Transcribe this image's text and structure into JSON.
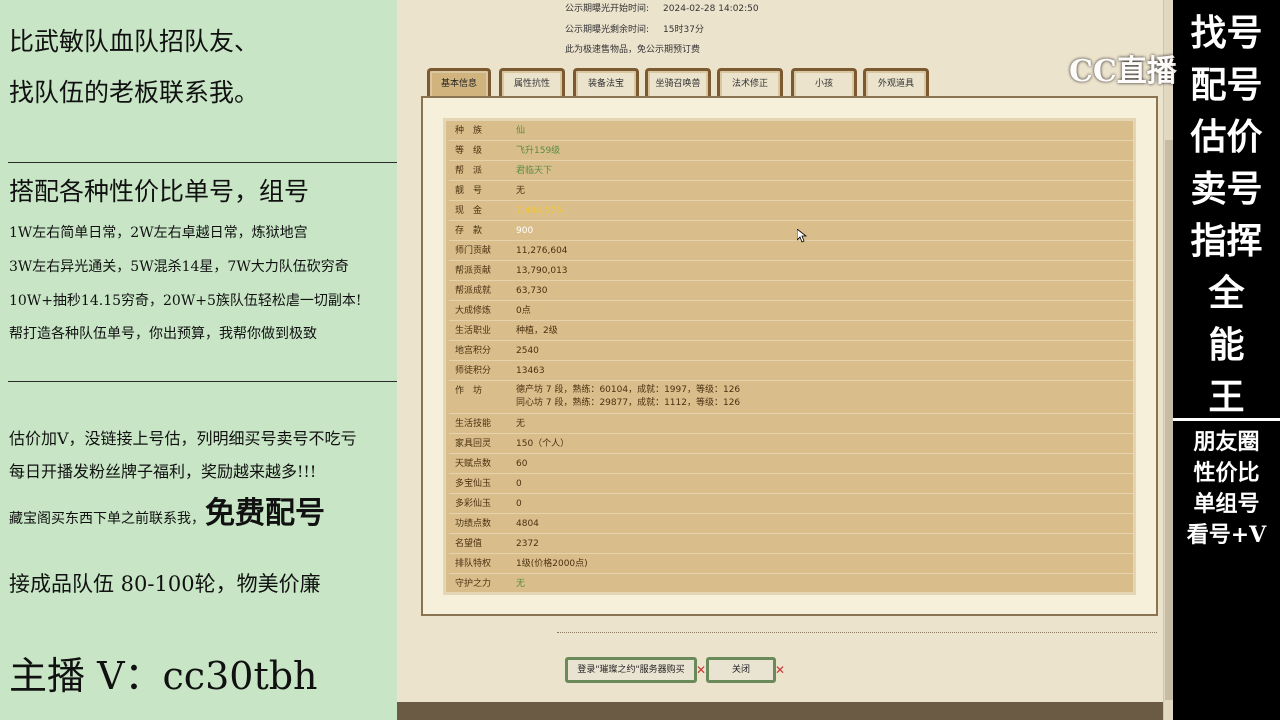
{
  "left": {
    "line1": "比武敏队血队招队友、",
    "line2": "找队伍的老板联系我。",
    "line3": "搭配各种性价比单号，组号",
    "line4": "1W左右简单日常，2W左右卓越日常，炼狱地宫",
    "line5": "3W左右异光通关，5W混杀14星，7W大力队伍砍穷奇",
    "line6": "10W+抽秒14.15穷奇，20W+5族队伍轻松虐一切副本!",
    "line7": "帮打造各种队伍单号，你出预算，我帮你做到极致",
    "line8": "估价加V，没链接上号估，列明细买号卖号不吃亏",
    "line9": "每日开播发粉丝牌子福利，奖励越来越多!!!",
    "line10a": "藏宝阁买东西下单之前联系我，",
    "line10b": "免费配号",
    "line11": "接成品队伍 80-100轮，物美价廉",
    "line12": "主播 V：cc30tbh"
  },
  "publicity": {
    "start_label": "公示期曝光开始时间:",
    "start_value": "2024-02-28 14:02:50",
    "remain_label": "公示期曝光剩余时间:",
    "remain_value": "15时37分",
    "note": "此为极速售物品，免公示期预订费"
  },
  "tabs": [
    "基本信息",
    "属性抗性",
    "装备法宝",
    "坐骑召唤兽",
    "法术修正",
    "小孩",
    "外观道具"
  ],
  "rows": [
    {
      "k": "种族",
      "v": "仙"
    },
    {
      "k": "等级",
      "v": "飞升159级"
    },
    {
      "k": "帮派",
      "v": "君临天下"
    },
    {
      "k": "靓号",
      "v": "无"
    },
    {
      "k": "现金",
      "v": "7,444,575"
    },
    {
      "k": "存款",
      "v": "900"
    },
    {
      "k": "师门贡献",
      "v": "11,276,604"
    },
    {
      "k": "帮派贡献",
      "v": "13,790,013"
    },
    {
      "k": "帮派成就",
      "v": "63,730"
    },
    {
      "k": "大成修炼",
      "v": "0点"
    },
    {
      "k": "生活职业",
      "v": "种植，2级"
    },
    {
      "k": "地宫积分",
      "v": "2540"
    },
    {
      "k": "师徒积分",
      "v": "13463"
    },
    {
      "k": "作坊",
      "v": "德产坊 7 段，熟练：60104，成就：1997，等级：126",
      "v2": "同心坊 7 段，熟练：29877，成就：1112，等级：126"
    },
    {
      "k": "生活技能",
      "v": "无"
    },
    {
      "k": "家具回灵",
      "v": "150（个人）"
    },
    {
      "k": "天赋点数",
      "v": "60"
    },
    {
      "k": "多宝仙玉",
      "v": "0"
    },
    {
      "k": "多彩仙玉",
      "v": "0"
    },
    {
      "k": "功绩点数",
      "v": "4804"
    },
    {
      "k": "名望值",
      "v": "2372"
    },
    {
      "k": "排队特权",
      "v": "1级(价格2000点)"
    },
    {
      "k": "守护之力",
      "v": "无"
    }
  ],
  "buttons": {
    "login": "登录\"璀璨之约\"服务器购买",
    "close": "关闭"
  },
  "right": {
    "chars": [
      "找号",
      "配号",
      "估价",
      "卖号",
      "指挥",
      "全",
      "能",
      "王"
    ],
    "small": [
      "朋友圈",
      "性价比",
      "单组号",
      "看号+V"
    ],
    "logo": "CC直播"
  }
}
